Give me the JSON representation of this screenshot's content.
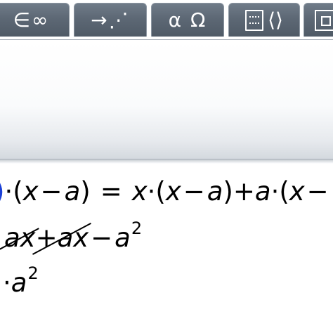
{
  "toolbar": {
    "tabs": [
      {
        "id": "symbols",
        "label": "∈∞"
      },
      {
        "id": "arrows",
        "label": "→⋰"
      },
      {
        "id": "greek",
        "label": "α Ω"
      },
      {
        "id": "matrix",
        "label": ""
      },
      {
        "id": "more",
        "label": ""
      }
    ],
    "tab_icons": [
      "element-infinity-icon",
      "arrow-dots-icon",
      "alpha-omega-icon",
      "matrix-brace-icon",
      "partial-box-icon"
    ],
    "colors": {
      "tab_fill": "#5d6875",
      "tab_text": "#ffffff"
    }
  },
  "worksheet": {
    "line1": {
      "lead": "·(",
      "x1": "x",
      "minus1": "−",
      "a1": "a",
      "close1": ")",
      "equals": "=",
      "x2": "x",
      "dot2": "·",
      "open2": "(",
      "x3": "x",
      "minus2": "−",
      "a2": "a",
      "close2": ")",
      "plus": "+",
      "a3": "a",
      "dot3": "·",
      "open3": "(",
      "x4": "x",
      "minus3": "−"
    },
    "line2": {
      "strike1": "ax",
      "strike2": "+ax",
      "minus": "−",
      "a": "a",
      "exp": "2"
    },
    "line3": {
      "lead": "·",
      "a": "a",
      "exp": "2"
    },
    "colors": {
      "highlight": "#1a3fd6"
    }
  }
}
